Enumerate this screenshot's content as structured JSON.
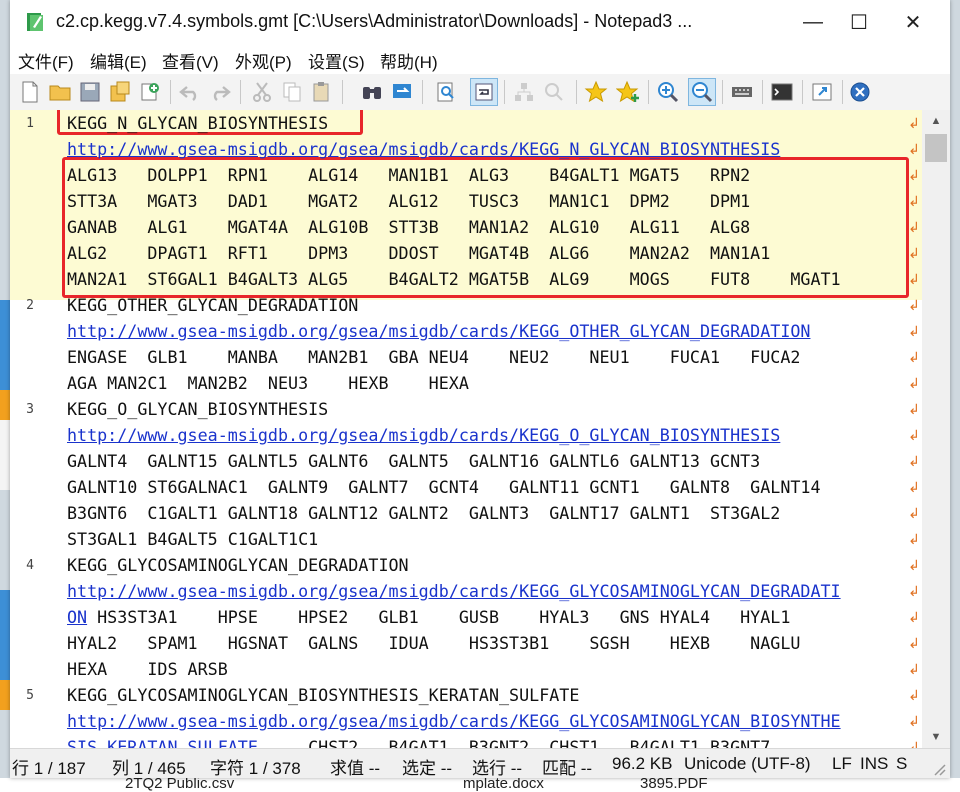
{
  "window": {
    "title": "c2.cp.kegg.v7.4.symbols.gmt [C:\\Users\\Administrator\\Downloads] - Notepad3 ...",
    "minimize": "—",
    "maximize": "☐",
    "close": "✕"
  },
  "menu": [
    "文件(F)",
    "编辑(E)",
    "查看(V)",
    "外观(P)",
    "设置(S)",
    "帮助(H)"
  ],
  "toolbar": {
    "icons": [
      "new-file-icon",
      "open-folder-icon",
      "save-icon",
      "save-as-icon",
      "save-copy-icon",
      "undo-icon",
      "redo-icon",
      "cut-icon",
      "copy-icon",
      "paste-icon",
      "find-icon",
      "replace-icon",
      "find-in-files-icon",
      "word-wrap-icon",
      "mark-all-icon",
      "goto-icon",
      "favorites-icon",
      "add-favorite-icon",
      "zoom-in-icon",
      "zoom-out-icon",
      "encoding-icon",
      "terminal-icon",
      "pin-icon",
      "exit-icon"
    ]
  },
  "editor": {
    "lines": [
      {
        "num": "1",
        "rows": [
          {
            "t": "KEGG_N_GLYCAN_BIOSYNTHESIS"
          },
          {
            "t": "http://www.gsea-msigdb.org/gsea/msigdb/cards/KEGG_N_GLYCAN_BIOSYNTHESIS",
            "url": true
          },
          {
            "t": "ALG13   DOLPP1  RPN1    ALG14   MAN1B1  ALG3    B4GALT1 MGAT5   RPN2"
          },
          {
            "t": "STT3A   MGAT3   DAD1    MGAT2   ALG12   TUSC3   MAN1C1  DPM2    DPM1"
          },
          {
            "t": "GANAB   ALG1    MGAT4A  ALG10B  STT3B   MAN1A2  ALG10   ALG11   ALG8"
          },
          {
            "t": "ALG2    DPAGT1  RFT1    DPM3    DDOST   MGAT4B  ALG6    MAN2A2  MAN1A1"
          },
          {
            "t": "MAN2A1  ST6GAL1 B4GALT3 ALG5    B4GALT2 MGAT5B  ALG9    MOGS    FUT8    MGAT1"
          }
        ]
      },
      {
        "num": "2",
        "rows": [
          {
            "t": "KEGG_OTHER_GLYCAN_DEGRADATION"
          },
          {
            "t": "http://www.gsea-msigdb.org/gsea/msigdb/cards/KEGG_OTHER_GLYCAN_DEGRADATION",
            "url": true
          },
          {
            "t": "ENGASE  GLB1    MANBA   MAN2B1  GBA NEU4    NEU2    NEU1    FUCA1   FUCA2"
          },
          {
            "t": "AGA MAN2C1  MAN2B2  NEU3    HEXB    HEXA"
          }
        ]
      },
      {
        "num": "3",
        "rows": [
          {
            "t": "KEGG_O_GLYCAN_BIOSYNTHESIS"
          },
          {
            "t": "http://www.gsea-msigdb.org/gsea/msigdb/cards/KEGG_O_GLYCAN_BIOSYNTHESIS",
            "url": true
          },
          {
            "t": "GALNT4  GALNT15 GALNTL5 GALNT6  GALNT5  GALNT16 GALNTL6 GALNT13 GCNT3"
          },
          {
            "t": "GALNT10 ST6GALNAC1  GALNT9  GALNT7  GCNT4   GALNT11 GCNT1   GALNT8  GALNT14"
          },
          {
            "t": "B3GNT6  C1GALT1 GALNT18 GALNT12 GALNT2  GALNT3  GALNT17 GALNT1  ST3GAL2"
          },
          {
            "t": "ST3GAL1 B4GALT5 C1GALT1C1"
          }
        ]
      },
      {
        "num": "4",
        "rows": [
          {
            "t": "KEGG_GLYCOSAMINOGLYCAN_DEGRADATION"
          },
          {
            "t": "http://www.gsea-msigdb.org/gsea/msigdb/cards/KEGG_GLYCOSAMINOGLYCAN_DEGRADATI",
            "url": true
          },
          {
            "t": "ON",
            "url": true,
            "rest": " HS3ST3A1    HPSE    HPSE2   GLB1    GUSB    HYAL3   GNS HYAL4   HYAL1"
          },
          {
            "t": "HYAL2   SPAM1   HGSNAT  GALNS   IDUA    HS3ST3B1    SGSH    HEXB    NAGLU"
          },
          {
            "t": "HEXA    IDS ARSB"
          }
        ]
      },
      {
        "num": "5",
        "rows": [
          {
            "t": "KEGG_GLYCOSAMINOGLYCAN_BIOSYNTHESIS_KERATAN_SULFATE"
          },
          {
            "t": "http://www.gsea-msigdb.org/gsea/msigdb/cards/KEGG_GLYCOSAMINOGLYCAN_BIOSYNTHE",
            "url": true
          },
          {
            "t": "SIS_KERATAN_SULFATE",
            "url": true,
            "rest": "     CHST2   B4GAT1  B3GNT2  CHST1   B4GALT1 B3GNT7"
          }
        ]
      }
    ]
  },
  "status": {
    "line": "行 1 / 187",
    "col": "列 1 / 465",
    "char": "字符 1 / 378",
    "sel_value": "求值 --",
    "select": "选定 --",
    "sel_lines": "选行 --",
    "match": "匹配 --",
    "size": "96.2 KB",
    "encoding": "Unicode (UTF-8)",
    "eol": "LF",
    "ins": "INS",
    "more": "S"
  },
  "desktop": {
    "file1": "2TQ2 Public.csv",
    "file2": "mplate.docx",
    "file3": "3895.PDF"
  },
  "colors": {
    "highlight": "#e8262a",
    "current_line": "#fdfbd3",
    "link": "#1a33cc"
  }
}
